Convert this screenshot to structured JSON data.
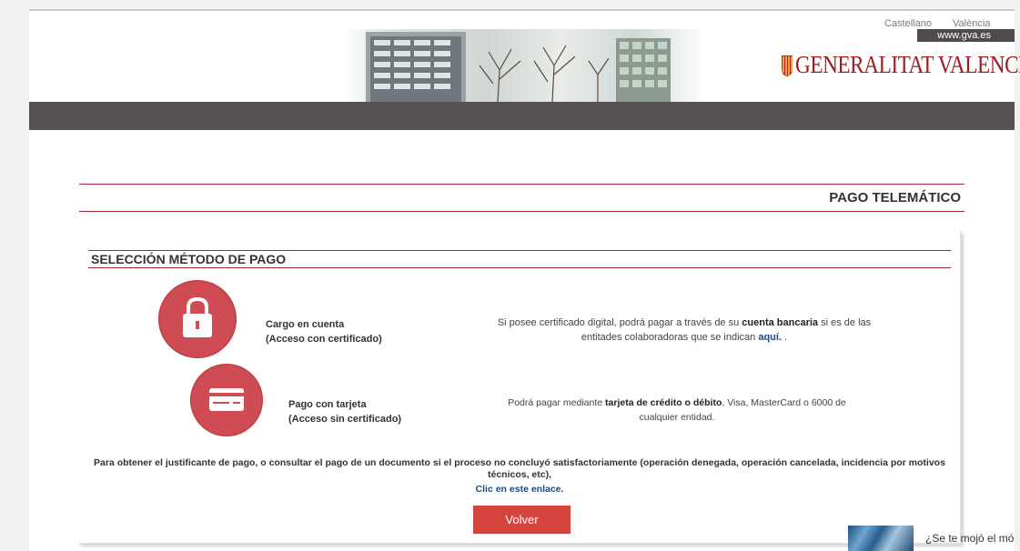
{
  "header": {
    "lang_castellano": "Castellano",
    "lang_valencia": "València",
    "gva_link": "www.gva.es",
    "brand_name": "GENERALITAT VALENCIANA"
  },
  "page_title": "PAGO TELEMÁTICO",
  "panel": {
    "title": "SELECCIÓN MÉTODO DE PAGO",
    "methods": [
      {
        "label_line1": "Cargo en cuenta",
        "label_line2": "(Acceso con certificado)",
        "icon": "lock-icon",
        "desc_pre": "Si posee certificado digital, podrá pagar a través de su ",
        "desc_bold": "cuenta bancaria",
        "desc_mid": " si es de las entitades colaboradoras que se indican ",
        "desc_link": "aquí.",
        "desc_post": " ."
      },
      {
        "label_line1": "Pago con tarjeta",
        "label_line2": "(Acceso sin certificado)",
        "icon": "credit-card-icon",
        "desc_pre": "Podrá pagar mediante ",
        "desc_bold": "tarjeta de crédito o débito",
        "desc_post": ", Visa, MasterCard o 6000 de cualquier entidad."
      }
    ],
    "justificante_text": "Para obtener el justificante de pago, o consultar el pago de un documento si el proceso no concluyó satisfactoriamente (operación denegada, operación cancelada, incidencia por motivos técnicos, etc),",
    "justificante_link": "Clic en este enlace.",
    "volver_label": "Volver"
  },
  "popup": {
    "text": "¿Se te mojó el mó"
  },
  "colors": {
    "accent_red": "#d04c54",
    "button_red": "#d6453d",
    "rule_color": "#a6283a",
    "nav_dark": "#575353",
    "link_blue": "#21497c"
  }
}
